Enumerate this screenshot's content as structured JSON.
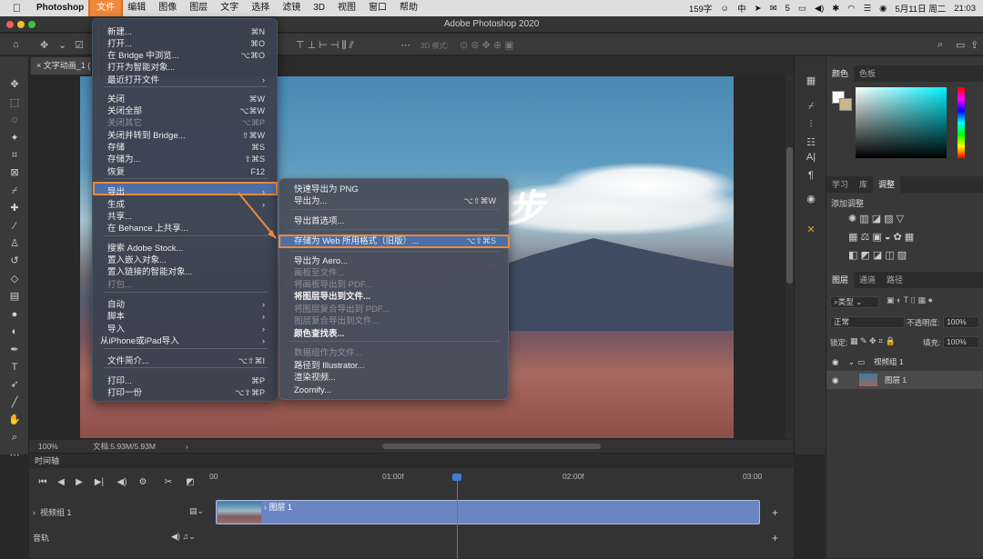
{
  "mac_menubar": {
    "apple": "",
    "items": [
      "Photoshop",
      "文件",
      "编辑",
      "图像",
      "图层",
      "文字",
      "选择",
      "滤镜",
      "3D",
      "视图",
      "窗口",
      "帮助"
    ],
    "status": {
      "lang": "159字",
      "wechat_count": "5",
      "date": "5月11日 周二",
      "time": "21:03",
      "ime": "中"
    }
  },
  "window": {
    "title": "Adobe Photoshop 2020"
  },
  "document": {
    "tab": "文字动画_1 (",
    "zoom": "100%",
    "docsize": "文档:5.93M/5.93M",
    "overlay_text": "步"
  },
  "file_menu": {
    "items": [
      {
        "label": "新建...",
        "shortcut": "⌘N"
      },
      {
        "label": "打开...",
        "shortcut": "⌘O"
      },
      {
        "label": "在 Bridge 中浏览...",
        "shortcut": "⌥⌘O"
      },
      {
        "label": "打开为智能对象...",
        "shortcut": ""
      },
      {
        "label": "最近打开文件",
        "shortcut": "›"
      },
      {
        "label": "关闭",
        "shortcut": "⌘W"
      },
      {
        "label": "关闭全部",
        "shortcut": "⌥⌘W"
      },
      {
        "label": "关闭其它",
        "shortcut": "⌥⌘P"
      },
      {
        "label": "关闭并转到 Bridge...",
        "shortcut": "⇧⌘W"
      },
      {
        "label": "存储",
        "shortcut": "⌘S"
      },
      {
        "label": "存储为...",
        "shortcut": "⇧⌘S"
      },
      {
        "label": "恢复",
        "shortcut": "F12"
      },
      {
        "label": "导出",
        "shortcut": "›"
      },
      {
        "label": "生成",
        "shortcut": "›"
      },
      {
        "label": "共享...",
        "shortcut": ""
      },
      {
        "label": "在 Behance 上共享...",
        "shortcut": ""
      },
      {
        "label": "搜索 Adobe Stock...",
        "shortcut": ""
      },
      {
        "label": "置入嵌入对象...",
        "shortcut": ""
      },
      {
        "label": "置入链接的智能对象...",
        "shortcut": ""
      },
      {
        "label": "打包...",
        "shortcut": ""
      },
      {
        "label": "自动",
        "shortcut": "›"
      },
      {
        "label": "脚本",
        "shortcut": "›"
      },
      {
        "label": "导入",
        "shortcut": "›"
      },
      {
        "label": "从iPhone或iPad导入",
        "shortcut": "›"
      },
      {
        "label": "文件简介...",
        "shortcut": "⌥⇧⌘I"
      },
      {
        "label": "打印...",
        "shortcut": "⌘P"
      },
      {
        "label": "打印一份",
        "shortcut": "⌥⇧⌘P"
      }
    ]
  },
  "export_menu": {
    "items": [
      {
        "label": "快速导出为 PNG",
        "shortcut": ""
      },
      {
        "label": "导出为...",
        "shortcut": "⌥⇧⌘W"
      },
      {
        "label": "导出首选项...",
        "shortcut": ""
      },
      {
        "label": "存储为 Web 所用格式（旧版）...",
        "shortcut": "⌥⇧⌘S"
      },
      {
        "label": "导出为 Aero...",
        "shortcut": ""
      },
      {
        "label": "画板至文件...",
        "shortcut": ""
      },
      {
        "label": "将画板导出到 PDF...",
        "shortcut": ""
      },
      {
        "label": "将图层导出到文件...",
        "shortcut": ""
      },
      {
        "label": "将图层复合导出到 PDF...",
        "shortcut": ""
      },
      {
        "label": "图层复合导出到文件...",
        "shortcut": ""
      },
      {
        "label": "颜色查找表...",
        "shortcut": ""
      },
      {
        "label": "数据组作为文件...",
        "shortcut": ""
      },
      {
        "label": "路径到 Illustrator...",
        "shortcut": ""
      },
      {
        "label": "渲染视频...",
        "shortcut": ""
      },
      {
        "label": "Zoomify...",
        "shortcut": ""
      }
    ]
  },
  "panels": {
    "color_tabs": [
      "颜色",
      "色板"
    ],
    "adjust_tabs": [
      "学习",
      "库",
      "调整"
    ],
    "adjust_title": "添加调整",
    "layer_tabs": [
      "图层",
      "通道",
      "路径"
    ],
    "kind": "类型",
    "blend": "正常",
    "opacity_label": "不透明度:",
    "opacity": "100%",
    "lock_label": "锁定:",
    "fill_label": "填充:",
    "fill": "100%",
    "group_name": "视频组 1",
    "layer_name": "图层 1"
  },
  "timeline": {
    "title": "时间轴",
    "ticks": [
      "00",
      "01:00f",
      "02:00f",
      "03:00"
    ],
    "track_group": "视频组 1",
    "audio": "音轨",
    "clip_label": "图层 1"
  },
  "colors": {
    "accent": "#f0883a",
    "highlight": "#4c6fa8",
    "clip": "#6a86c2"
  }
}
